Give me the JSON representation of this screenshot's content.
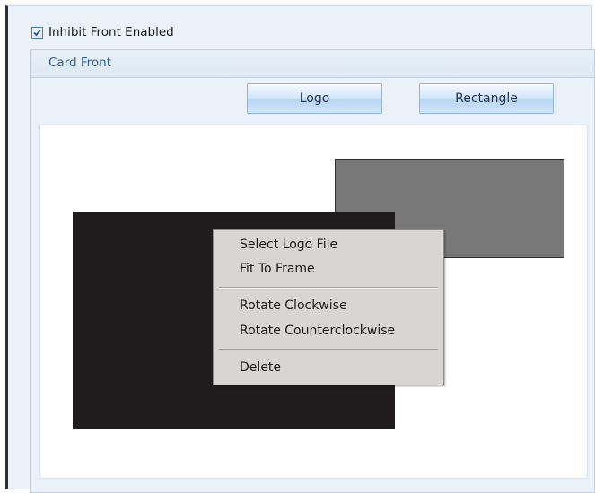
{
  "inhibit": {
    "label": "Inhibit Front Enabled",
    "checked": true
  },
  "card_front": {
    "title": "Card Front",
    "buttons": {
      "logo": "Logo",
      "rectangle": "Rectangle"
    }
  },
  "context_menu": {
    "items": [
      "Select Logo File",
      "Fit To Frame",
      "Rotate Clockwise",
      "Rotate Counterclockwise",
      "Delete"
    ]
  },
  "colors": {
    "rectangle_fill": "#787878",
    "logo_fill": "#1e1c1d",
    "menu_bg": "#d8d6d2"
  }
}
